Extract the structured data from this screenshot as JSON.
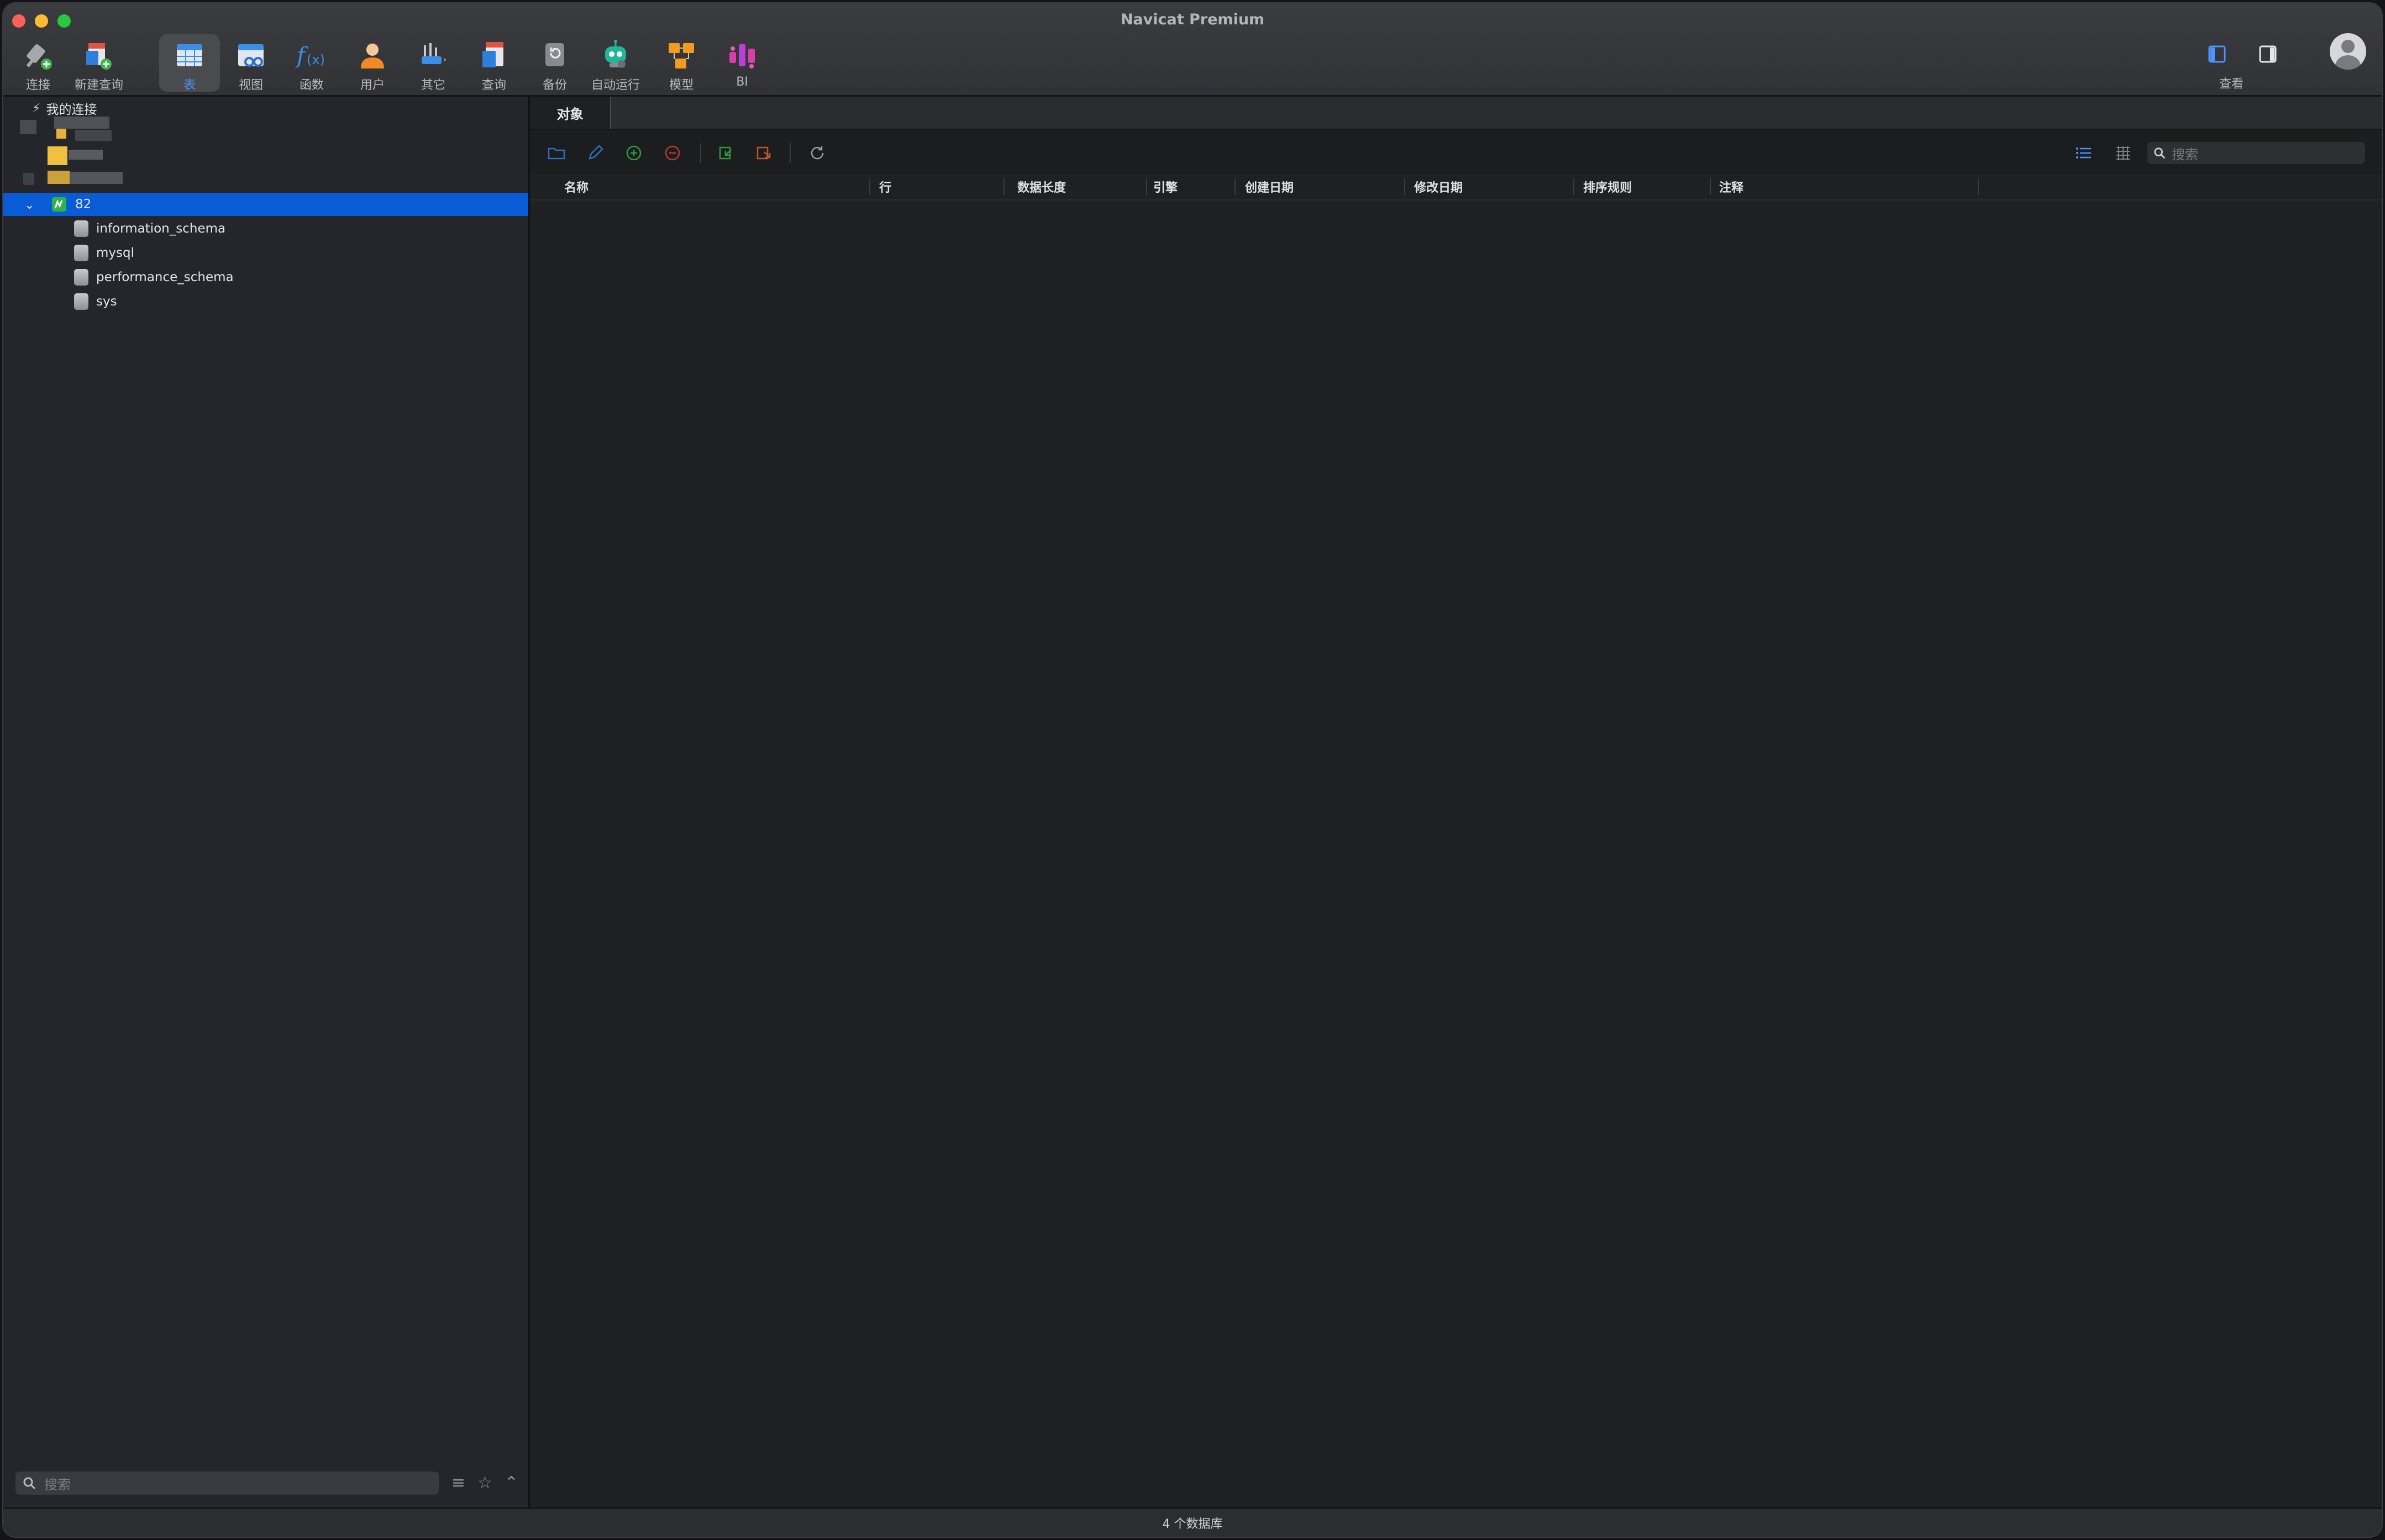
{
  "window": {
    "title": "Navicat Premium"
  },
  "toolbar": {
    "items": [
      {
        "label": "连接",
        "icon": "connection-plug-icon"
      },
      {
        "label": "新建查询",
        "icon": "new-query-icon"
      },
      {
        "label": "表",
        "icon": "table-icon",
        "active": true
      },
      {
        "label": "视图",
        "icon": "view-icon"
      },
      {
        "label": "函数",
        "icon": "function-icon"
      },
      {
        "label": "用户",
        "icon": "user-icon"
      },
      {
        "label": "其它",
        "icon": "other-icon"
      },
      {
        "label": "查询",
        "icon": "query-icon"
      },
      {
        "label": "备份",
        "icon": "backup-icon"
      },
      {
        "label": "自动运行",
        "icon": "automation-robot-icon"
      },
      {
        "label": "模型",
        "icon": "model-icon"
      },
      {
        "label": "BI",
        "icon": "bi-icon"
      }
    ],
    "view_label": "查看"
  },
  "sidebar": {
    "group_label": "我的连接",
    "connection": "82",
    "databases": [
      "information_schema",
      "mysql",
      "performance_schema",
      "sys"
    ],
    "search_placeholder": "搜索"
  },
  "main": {
    "tab_label": "对象",
    "search_placeholder": "搜索",
    "columns": [
      "名称",
      "行",
      "数据长度",
      "引擎",
      "创建日期",
      "修改日期",
      "排序规则",
      "注释"
    ]
  },
  "status": {
    "text": "4 个数据库"
  },
  "colors": {
    "accent": "#0a5bd6",
    "active_label": "#4b93ff"
  }
}
